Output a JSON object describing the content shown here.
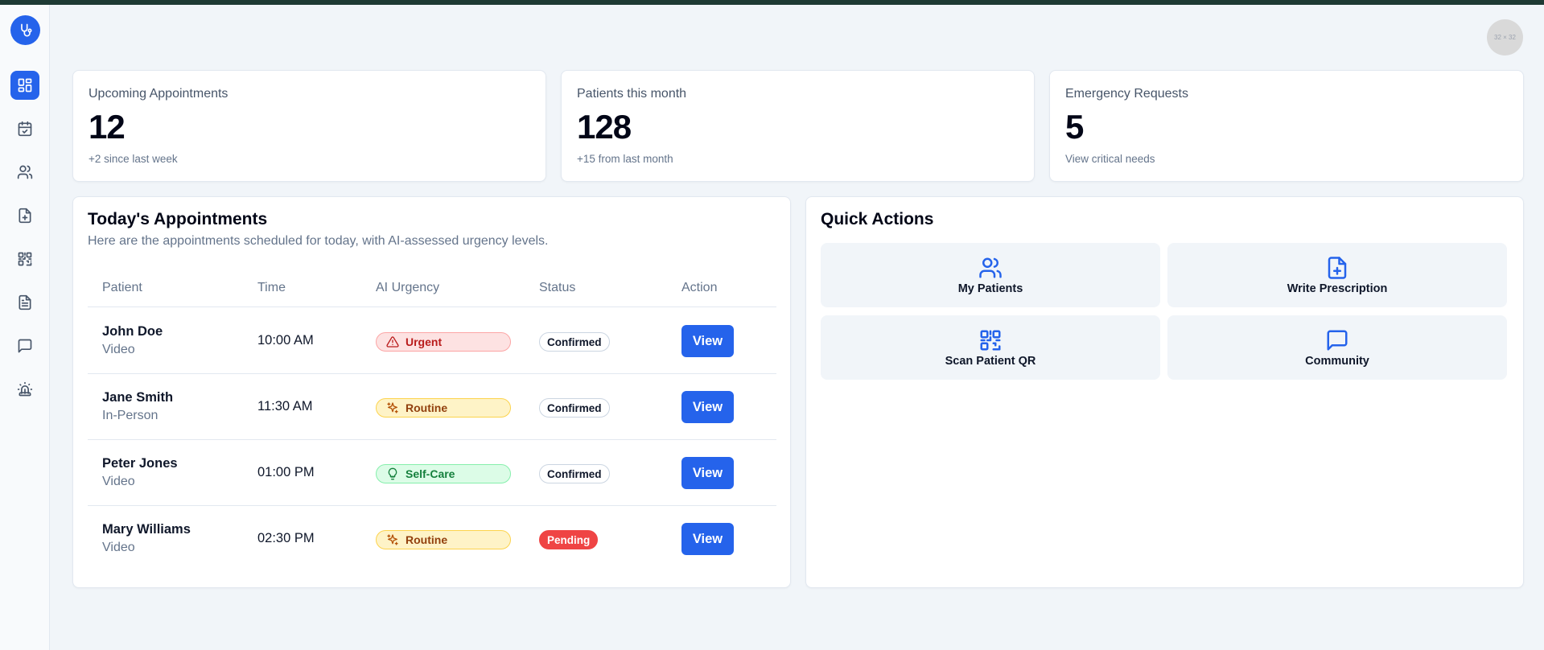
{
  "colors": {
    "accent": "#2563eb",
    "urgent": "#b91c1c",
    "routine": "#92400e",
    "self_care": "#15803d",
    "pending": "#ef4444"
  },
  "sidebar": {
    "logo_icon": "stethoscope-icon",
    "items": [
      {
        "icon": "dashboard-icon",
        "active": true
      },
      {
        "icon": "calendar-check-icon",
        "active": false
      },
      {
        "icon": "users-icon",
        "active": false
      },
      {
        "icon": "file-plus-icon",
        "active": false
      },
      {
        "icon": "qr-code-icon",
        "active": false
      },
      {
        "icon": "file-text-icon",
        "active": false
      },
      {
        "icon": "message-square-icon",
        "active": false
      },
      {
        "icon": "siren-icon",
        "active": false
      }
    ]
  },
  "header": {
    "avatar_text": "32 × 32"
  },
  "stats": [
    {
      "title": "Upcoming Appointments",
      "value": "12",
      "sub": "+2 since last week"
    },
    {
      "title": "Patients this month",
      "value": "128",
      "sub": "+15 from last month"
    },
    {
      "title": "Emergency Requests",
      "value": "5",
      "sub": "View critical needs"
    }
  ],
  "appointments": {
    "title": "Today's Appointments",
    "description": "Here are the appointments scheduled for today, with AI-assessed urgency levels.",
    "columns": [
      "Patient",
      "Time",
      "AI Urgency",
      "Status",
      "Action"
    ],
    "rows": [
      {
        "name": "John Doe",
        "type": "Video",
        "time": "10:00 AM",
        "urgency": "Urgent",
        "status": "Confirmed",
        "action": "View"
      },
      {
        "name": "Jane Smith",
        "type": "In-Person",
        "time": "11:30 AM",
        "urgency": "Routine",
        "status": "Confirmed",
        "action": "View"
      },
      {
        "name": "Peter Jones",
        "type": "Video",
        "time": "01:00 PM",
        "urgency": "Self-Care",
        "status": "Confirmed",
        "action": "View"
      },
      {
        "name": "Mary Williams",
        "type": "Video",
        "time": "02:30 PM",
        "urgency": "Routine",
        "status": "Pending",
        "action": "View"
      }
    ]
  },
  "quick_actions": {
    "title": "Quick Actions",
    "items": [
      {
        "label": "My Patients",
        "icon": "users-icon"
      },
      {
        "label": "Write Prescription",
        "icon": "file-plus-icon"
      },
      {
        "label": "Scan Patient QR",
        "icon": "qr-code-icon"
      },
      {
        "label": "Community",
        "icon": "message-square-icon"
      }
    ]
  }
}
